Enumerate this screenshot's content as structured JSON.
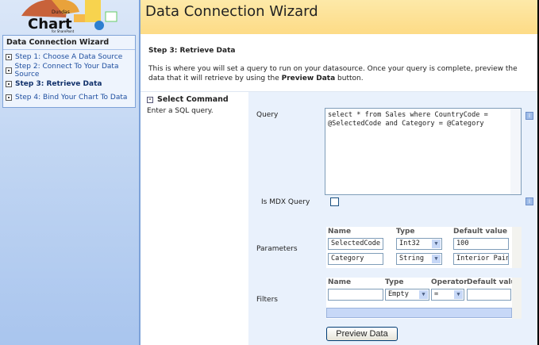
{
  "logo": {
    "text": "Dundas Chart for SharePoint"
  },
  "sidebar": {
    "title": "Data Connection Wizard",
    "steps": [
      {
        "label": "Step 1: Choose A Data Source"
      },
      {
        "label": "Step 2: Connect To Your Data Source"
      },
      {
        "label": "Step 3: Retrieve Data"
      },
      {
        "label": "Step 4: Bind Your Chart To Data"
      }
    ]
  },
  "header": {
    "title": "Data Connection Wizard"
  },
  "main": {
    "step_title": "Step 3: Retrieve Data",
    "desc_pre": "This is where you will set a query to run on your datasource. Once your query is complete, preview the data that it will retrieve by using the ",
    "desc_bold": "Preview Data",
    "desc_post": " button.",
    "section_title": "Select Command",
    "section_desc": "Enter a SQL query.",
    "query_label": "Query",
    "query_value": "select * from Sales where CountryCode = @SelectedCode and Category = @Category",
    "mdx_label": "Is MDX Query",
    "mdx_checked": false,
    "parameters_label": "Parameters",
    "param_headers": [
      "Name",
      "Type",
      "Default value"
    ],
    "params": [
      {
        "name": "SelectedCode",
        "type": "Int32",
        "default": "100"
      },
      {
        "name": "Category",
        "type": "String",
        "default": "Interior Paint"
      }
    ],
    "filters_label": "Filters",
    "filter_headers": [
      "Name",
      "Type",
      "Operator",
      "Default value"
    ],
    "filters": [
      {
        "name": "",
        "type": "Empty",
        "operator": "=",
        "default": ""
      }
    ],
    "preview_button": "Preview Data"
  }
}
